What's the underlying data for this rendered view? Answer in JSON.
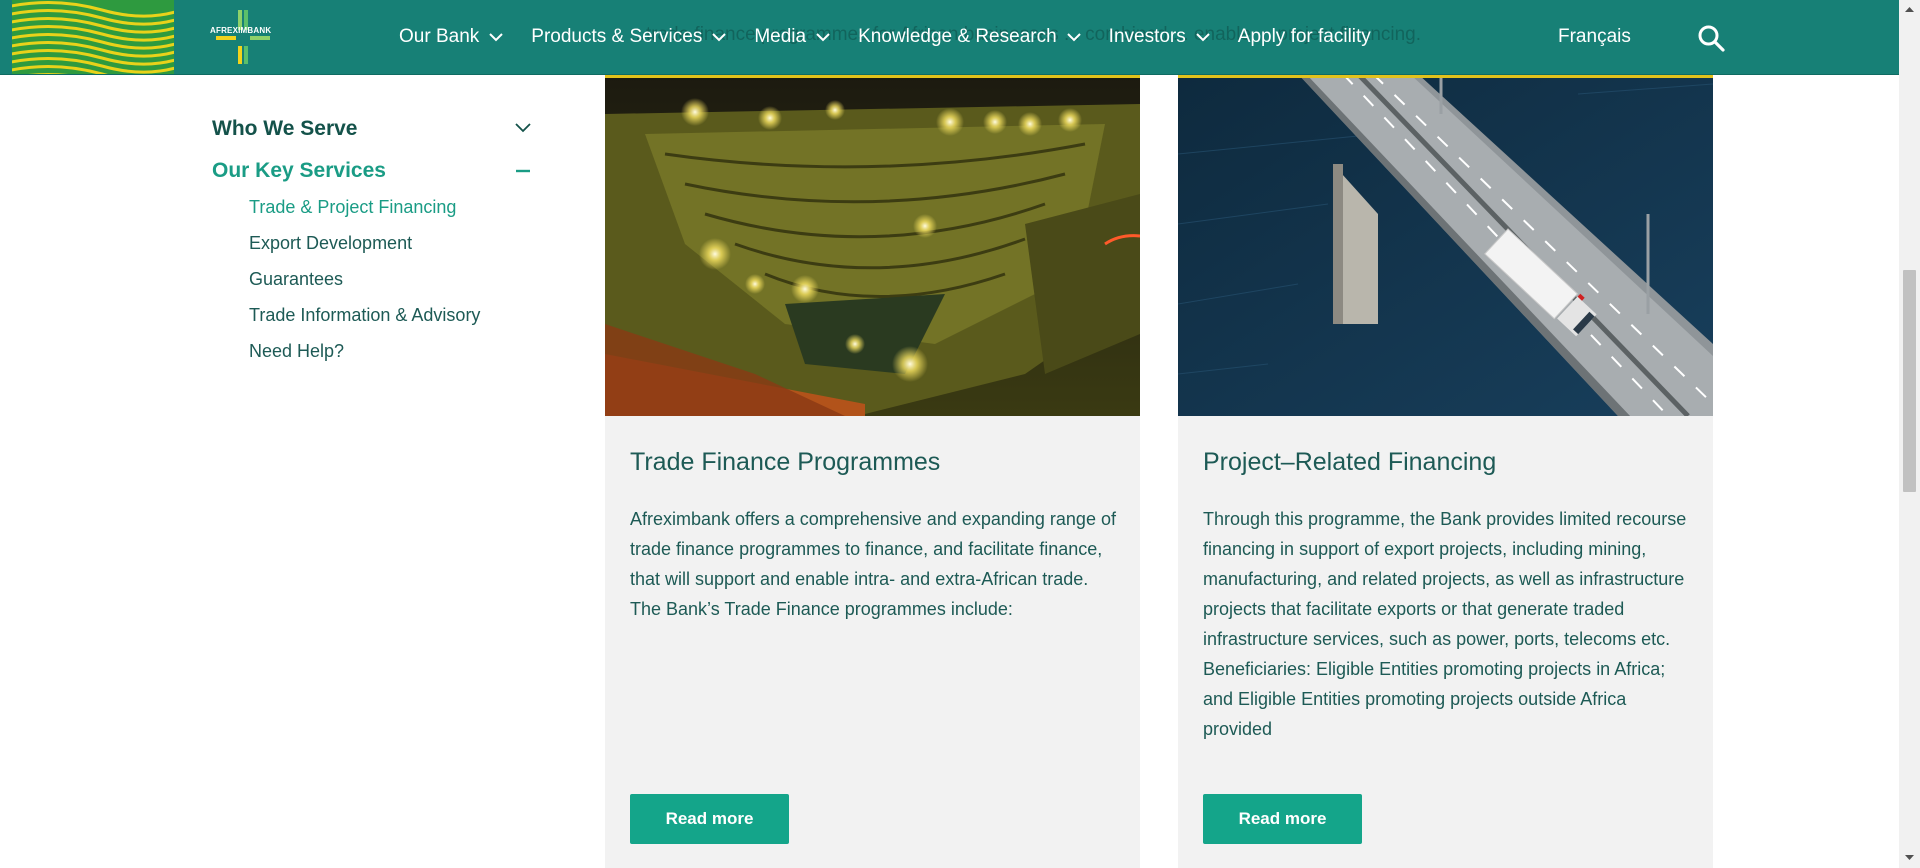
{
  "header": {
    "logo_text": "AFREXIMBANK",
    "ghost_text": "...trade finance programmes for African businesses ... combined ... enable ... project financing.",
    "nav": [
      {
        "label": "Our Bank",
        "has_dropdown": true
      },
      {
        "label": "Products & Services",
        "has_dropdown": true
      },
      {
        "label": "Media",
        "has_dropdown": true
      },
      {
        "label": "Knowledge & Research",
        "has_dropdown": true
      },
      {
        "label": "Investors",
        "has_dropdown": true
      },
      {
        "label": "Apply for facility",
        "has_dropdown": false
      }
    ],
    "language": "Français",
    "search_icon": "search-icon"
  },
  "sidebar": {
    "sections": [
      {
        "label": "Who We Serve",
        "state": "collapsed",
        "icon": "chevron-down-icon"
      },
      {
        "label": "Our Key Services",
        "state": "expanded",
        "icon": "minus-icon"
      }
    ],
    "items": [
      {
        "label": "Trade & Project Financing",
        "active": true
      },
      {
        "label": "Export Development",
        "active": false
      },
      {
        "label": "Guarantees",
        "active": false
      },
      {
        "label": "Trade Information & Advisory",
        "active": false
      },
      {
        "label": "Need Help?",
        "active": false
      }
    ]
  },
  "cards": [
    {
      "title": "Trade Finance Programmes",
      "body": "Afreximbank offers a comprehensive and expanding range of trade finance programmes to finance, and facilitate finance, that will support and enable intra- and extra-African trade. The Bank’s Trade Finance programmes include:",
      "button": "Read more",
      "image": "open-pit-mine-at-night"
    },
    {
      "title": "Project–Related Financing",
      "body": "Through this programme, the Bank provides limited recourse financing in support of export projects, including mining, manufacturing, and related projects, as well as infrastructure projects that facilitate exports or that generate traded infrastructure services, such as power, ports, telecoms etc. Beneficiaries: Eligible Entities promoting projects in Africa; and Eligible Entities promoting projects outside Africa provided",
      "button": "Read more",
      "image": "bridge-with-truck-over-water"
    }
  ],
  "colors": {
    "header": "#178076",
    "accent": "#1a9c85",
    "button": "#14a58a",
    "text": "#1d5a55",
    "card_bg": "#f2f2f2",
    "image_border": "#e2c21c"
  }
}
